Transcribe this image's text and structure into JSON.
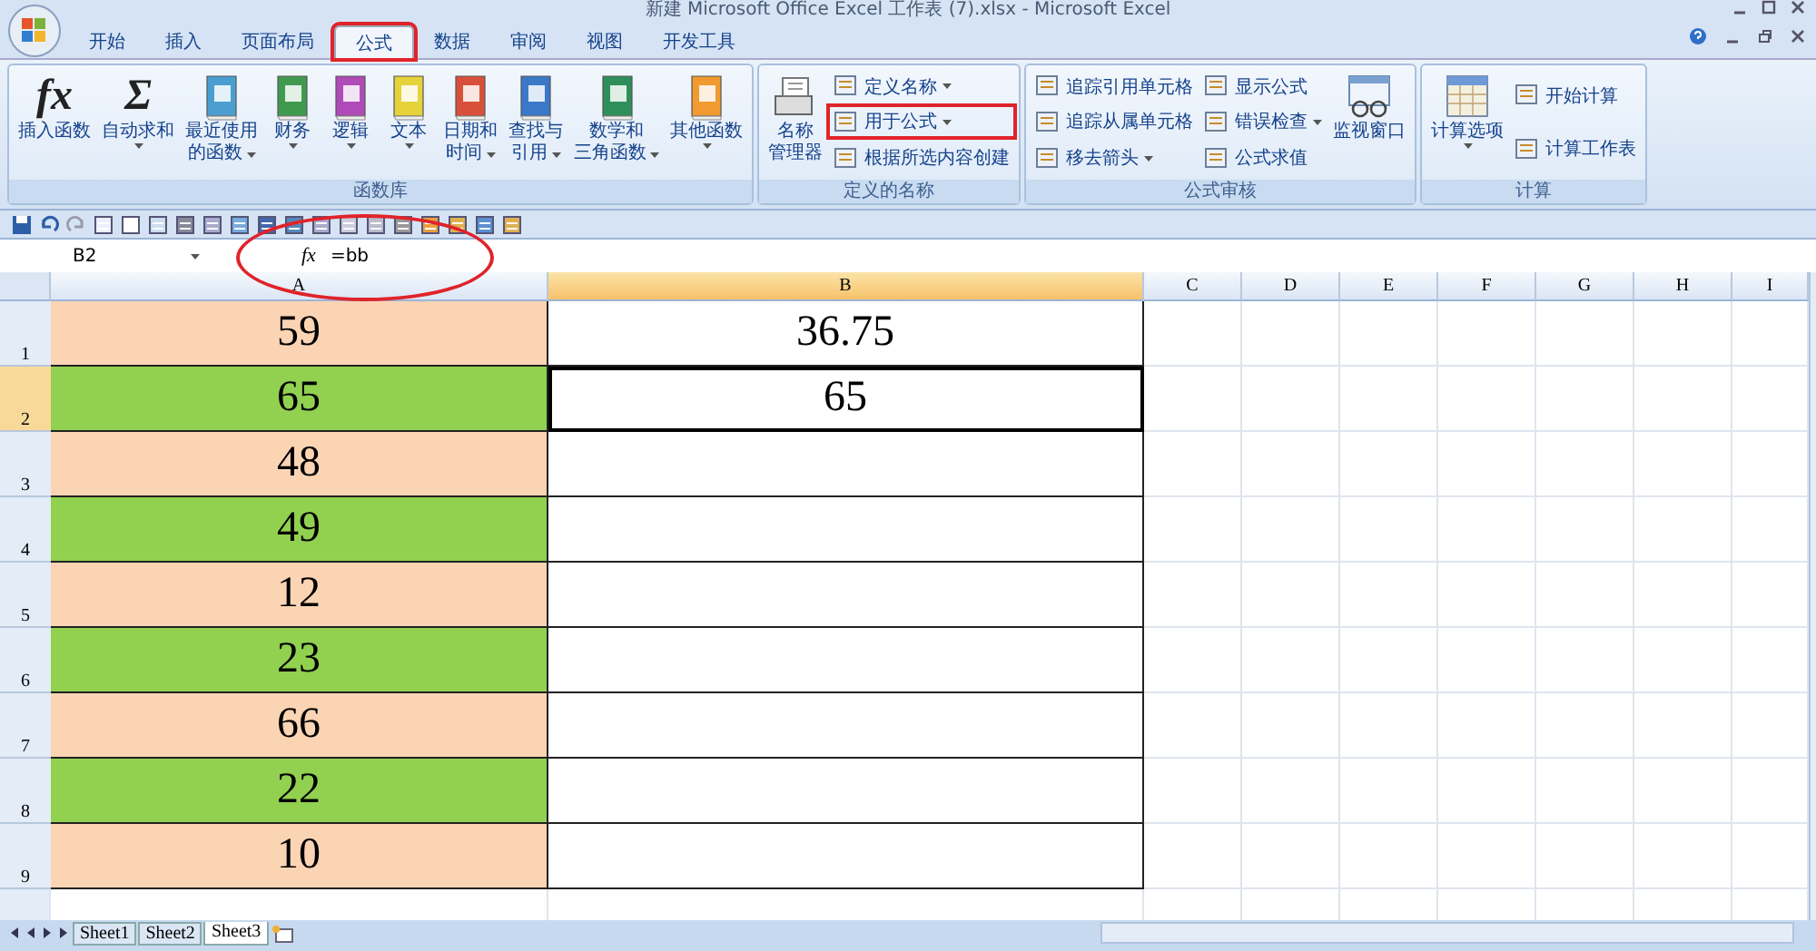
{
  "window": {
    "title": "新建 Microsoft Office Excel 工作表 (7).xlsx - Microsoft Excel"
  },
  "tabs": [
    {
      "label": "开始",
      "selected": false,
      "highlighted": false
    },
    {
      "label": "插入",
      "selected": false,
      "highlighted": false
    },
    {
      "label": "页面布局",
      "selected": false,
      "highlighted": false
    },
    {
      "label": "公式",
      "selected": true,
      "highlighted": true
    },
    {
      "label": "数据",
      "selected": false,
      "highlighted": false
    },
    {
      "label": "审阅",
      "selected": false,
      "highlighted": false
    },
    {
      "label": "视图",
      "selected": false,
      "highlighted": false
    },
    {
      "label": "开发工具",
      "selected": false,
      "highlighted": false
    }
  ],
  "ribbon": [
    {
      "label": "函数库",
      "items": [
        {
          "kind": "large",
          "glyph": "fx",
          "lines": [
            "插入函数"
          ],
          "dropdown": false
        },
        {
          "kind": "large",
          "glyph": "Σ",
          "lines": [
            "自动求和"
          ],
          "dropdown": true
        },
        {
          "kind": "large",
          "lines": [
            "最近使用",
            "的函数"
          ],
          "dropdown": true,
          "color": "#4a9fd0"
        },
        {
          "kind": "large",
          "lines": [
            "财务"
          ],
          "dropdown": true,
          "color": "#3f9a50"
        },
        {
          "kind": "large",
          "lines": [
            "逻辑"
          ],
          "dropdown": true,
          "color": "#b04ab8"
        },
        {
          "kind": "large",
          "lines": [
            "文本"
          ],
          "dropdown": true,
          "color": "#e6d23a"
        },
        {
          "kind": "large",
          "lines": [
            "日期和",
            "时间"
          ],
          "dropdown": true,
          "color": "#d8503a"
        },
        {
          "kind": "large",
          "lines": [
            "查找与",
            "引用"
          ],
          "dropdown": true,
          "color": "#3a78c8"
        },
        {
          "kind": "large",
          "lines": [
            "数学和",
            "三角函数"
          ],
          "dropdown": true,
          "color": "#2f8f5a"
        },
        {
          "kind": "large",
          "lines": [
            "其他函数"
          ],
          "dropdown": true,
          "color": "#f09a30"
        }
      ]
    },
    {
      "label": "定义的名称",
      "items": [
        {
          "kind": "large",
          "lines": [
            "名称",
            "管理器"
          ],
          "dropdown": false
        },
        {
          "kind": "stack",
          "entries": [
            {
              "label": "定义名称",
              "dropdown": true,
              "highlighted": false
            },
            {
              "label": "用于公式",
              "dropdown": true,
              "highlighted": true
            },
            {
              "label": "根据所选内容创建",
              "dropdown": false,
              "highlighted": false
            }
          ]
        }
      ]
    },
    {
      "label": "公式审核",
      "items": [
        {
          "kind": "stack",
          "entries": [
            {
              "label": "追踪引用单元格",
              "dropdown": false,
              "highlighted": false
            },
            {
              "label": "追踪从属单元格",
              "dropdown": false,
              "highlighted": false
            },
            {
              "label": "移去箭头",
              "dropdown": true,
              "highlighted": false
            }
          ]
        },
        {
          "kind": "stack",
          "entries": [
            {
              "label": "显示公式",
              "dropdown": false,
              "highlighted": false
            },
            {
              "label": "错误检查",
              "dropdown": true,
              "highlighted": false
            },
            {
              "label": "公式求值",
              "dropdown": false,
              "highlighted": false
            }
          ]
        },
        {
          "kind": "large",
          "lines": [
            "监视窗口"
          ],
          "dropdown": false
        }
      ]
    },
    {
      "label": "计算",
      "items": [
        {
          "kind": "large",
          "lines": [
            "计算选项"
          ],
          "dropdown": true
        },
        {
          "kind": "stack",
          "entries": [
            {
              "label": "开始计算",
              "dropdown": false,
              "highlighted": false
            },
            {
              "label": "计算工作表",
              "dropdown": false,
              "highlighted": false
            }
          ]
        }
      ]
    }
  ],
  "formula_bar": {
    "name_box": "B2",
    "fx": "fx",
    "formula": "=bb",
    "circled": true
  },
  "columns": [
    {
      "label": "A",
      "selected": false
    },
    {
      "label": "B",
      "selected": true
    },
    {
      "label": "C",
      "selected": false
    },
    {
      "label": "D",
      "selected": false
    },
    {
      "label": "E",
      "selected": false
    },
    {
      "label": "F",
      "selected": false
    },
    {
      "label": "G",
      "selected": false
    },
    {
      "label": "H",
      "selected": false
    },
    {
      "label": "I",
      "selected": false
    }
  ],
  "rows": [
    {
      "label": "1",
      "selected": false,
      "cells": [
        {
          "value": "59",
          "color": "#fbd4b4",
          "selected": false
        },
        {
          "value": "36.75",
          "selected": false
        }
      ]
    },
    {
      "label": "2",
      "selected": true,
      "cells": [
        {
          "value": "65",
          "color": "#92d050",
          "selected": false
        },
        {
          "value": "65",
          "selected": true
        }
      ]
    },
    {
      "label": "3",
      "selected": false,
      "cells": [
        {
          "value": "48",
          "color": "#fbd4b4",
          "selected": false
        },
        {
          "selected": false
        }
      ]
    },
    {
      "label": "4",
      "selected": false,
      "cells": [
        {
          "value": "49",
          "color": "#92d050",
          "selected": false
        },
        {
          "selected": false
        }
      ]
    },
    {
      "label": "5",
      "selected": false,
      "cells": [
        {
          "value": "12",
          "color": "#fbd4b4",
          "selected": false
        },
        {
          "selected": false
        }
      ]
    },
    {
      "label": "6",
      "selected": false,
      "cells": [
        {
          "value": "23",
          "color": "#92d050",
          "selected": false
        },
        {
          "selected": false
        }
      ]
    },
    {
      "label": "7",
      "selected": false,
      "cells": [
        {
          "value": "66",
          "color": "#fbd4b4",
          "selected": false
        },
        {
          "selected": false
        }
      ]
    },
    {
      "label": "8",
      "selected": false,
      "cells": [
        {
          "value": "22",
          "color": "#92d050",
          "selected": false
        },
        {
          "selected": false
        }
      ]
    },
    {
      "label": "9",
      "selected": false,
      "cells": [
        {
          "value": "10",
          "color": "#fbd4b4",
          "selected": false
        },
        {
          "selected": false
        }
      ]
    }
  ],
  "sheets": [
    {
      "label": "Sheet1",
      "selected": false
    },
    {
      "label": "Sheet2",
      "selected": false
    },
    {
      "label": "Sheet3",
      "selected": true
    }
  ]
}
